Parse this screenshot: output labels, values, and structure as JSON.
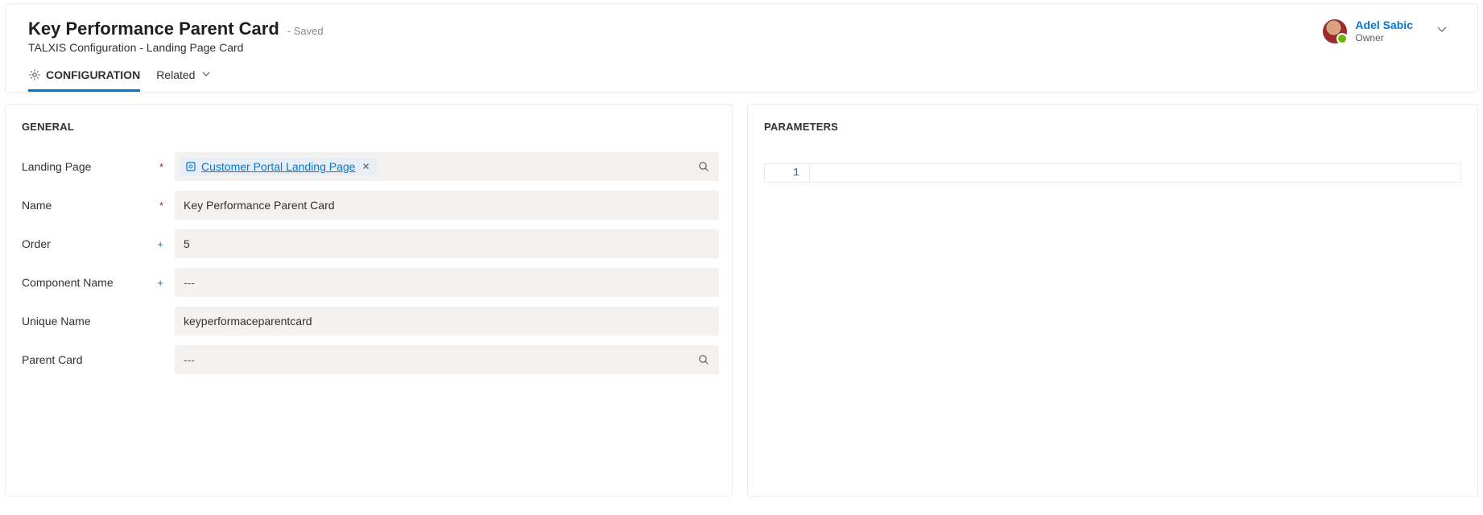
{
  "header": {
    "title": "Key Performance Parent Card",
    "saved_suffix": "- Saved",
    "subtitle": "TALXIS Configuration - Landing Page Card"
  },
  "owner": {
    "name": "Adel Sabic",
    "role_label": "Owner"
  },
  "tabs": {
    "configuration_label": "CONFIGURATION",
    "related_label": "Related"
  },
  "general": {
    "section_title": "GENERAL",
    "fields": {
      "landing_page": {
        "label": "Landing Page",
        "required_mark": "*",
        "tag_text": "Customer Portal Landing Page"
      },
      "name": {
        "label": "Name",
        "required_mark": "*",
        "value": "Key Performance Parent Card"
      },
      "order": {
        "label": "Order",
        "required_mark": "+",
        "value": "5"
      },
      "component_name": {
        "label": "Component Name",
        "required_mark": "+",
        "value": "---"
      },
      "unique_name": {
        "label": "Unique Name",
        "required_mark": "",
        "value": "keyperformaceparentcard"
      },
      "parent_card": {
        "label": "Parent Card",
        "required_mark": "",
        "value": "---"
      }
    }
  },
  "parameters": {
    "section_title": "PARAMETERS",
    "line_number": "1",
    "content": ""
  }
}
